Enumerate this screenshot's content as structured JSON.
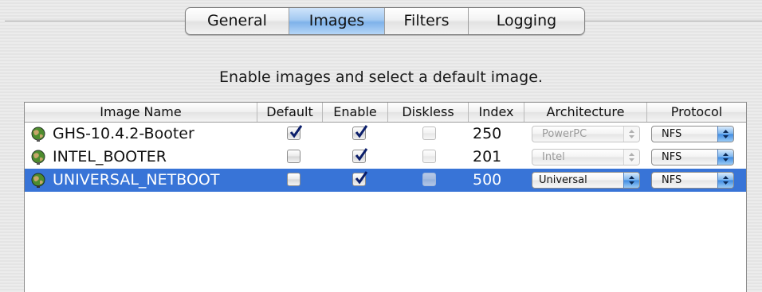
{
  "tabs": [
    {
      "label": "General",
      "selected": false
    },
    {
      "label": "Images",
      "selected": true
    },
    {
      "label": "Filters",
      "selected": false
    },
    {
      "label": "Logging",
      "selected": false
    }
  ],
  "heading": "Enable images and select a default image.",
  "table": {
    "columns": [
      "Image Name",
      "Default",
      "Enable",
      "Diskless",
      "Index",
      "Architecture",
      "Protocol"
    ],
    "rows": [
      {
        "name": "GHS-10.4.2-Booter",
        "default": true,
        "enable": true,
        "diskless": false,
        "index": "250",
        "architecture": "PowerPC",
        "architecture_enabled": false,
        "protocol": "NFS",
        "selected": false
      },
      {
        "name": "INTEL_BOOTER",
        "default": false,
        "enable": true,
        "diskless": false,
        "index": "201",
        "architecture": "Intel",
        "architecture_enabled": false,
        "protocol": "NFS",
        "selected": false
      },
      {
        "name": "UNIVERSAL_NETBOOT",
        "default": false,
        "enable": true,
        "diskless": false,
        "index": "500",
        "architecture": "Universal",
        "architecture_enabled": true,
        "protocol": "NFS",
        "selected": true
      }
    ]
  },
  "colors": {
    "selection": "#3874d7",
    "checkmark": "#0c1f6b",
    "tab_selected": "#a3c9f1"
  },
  "icons": {
    "row_icon": "netboot-globe-icon",
    "popup_arrows": "up-down-arrows-icon"
  }
}
